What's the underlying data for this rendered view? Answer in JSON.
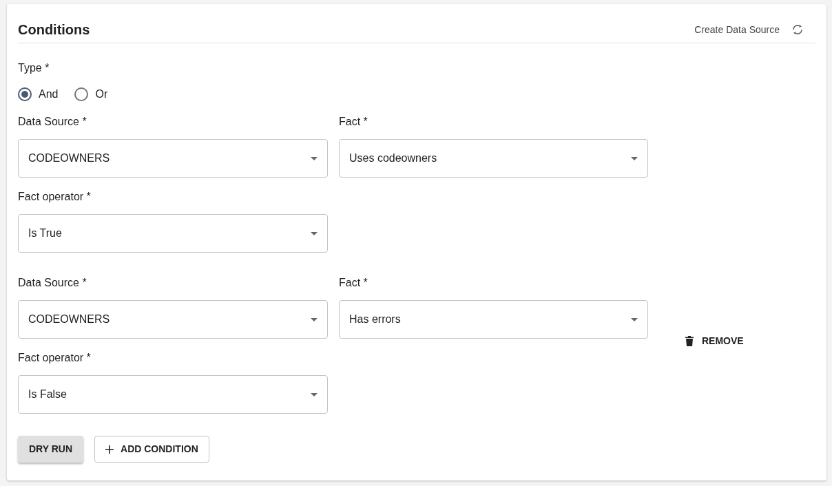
{
  "header": {
    "title": "Conditions",
    "action": "Create Data Source"
  },
  "type": {
    "label": "Type *",
    "options": [
      {
        "label": "And",
        "selected": true
      },
      {
        "label": "Or",
        "selected": false
      }
    ]
  },
  "conditions": [
    {
      "source_label": "Data Source *",
      "source": "CODEOWNERS",
      "fact_label": "Fact *",
      "fact": "Uses codeowners",
      "operator_label": "Fact operator *",
      "operator": "Is True",
      "removable": false
    },
    {
      "source_label": "Data Source *",
      "source": "CODEOWNERS",
      "fact_label": "Fact *",
      "fact": "Has errors",
      "operator_label": "Fact operator *",
      "operator": "Is False",
      "removable": true,
      "remove_label": "REMOVE"
    }
  ],
  "buttons": [
    {
      "kind": "dry",
      "label": "DRY RUN"
    },
    {
      "kind": "add",
      "label": "ADD CONDITION"
    }
  ]
}
